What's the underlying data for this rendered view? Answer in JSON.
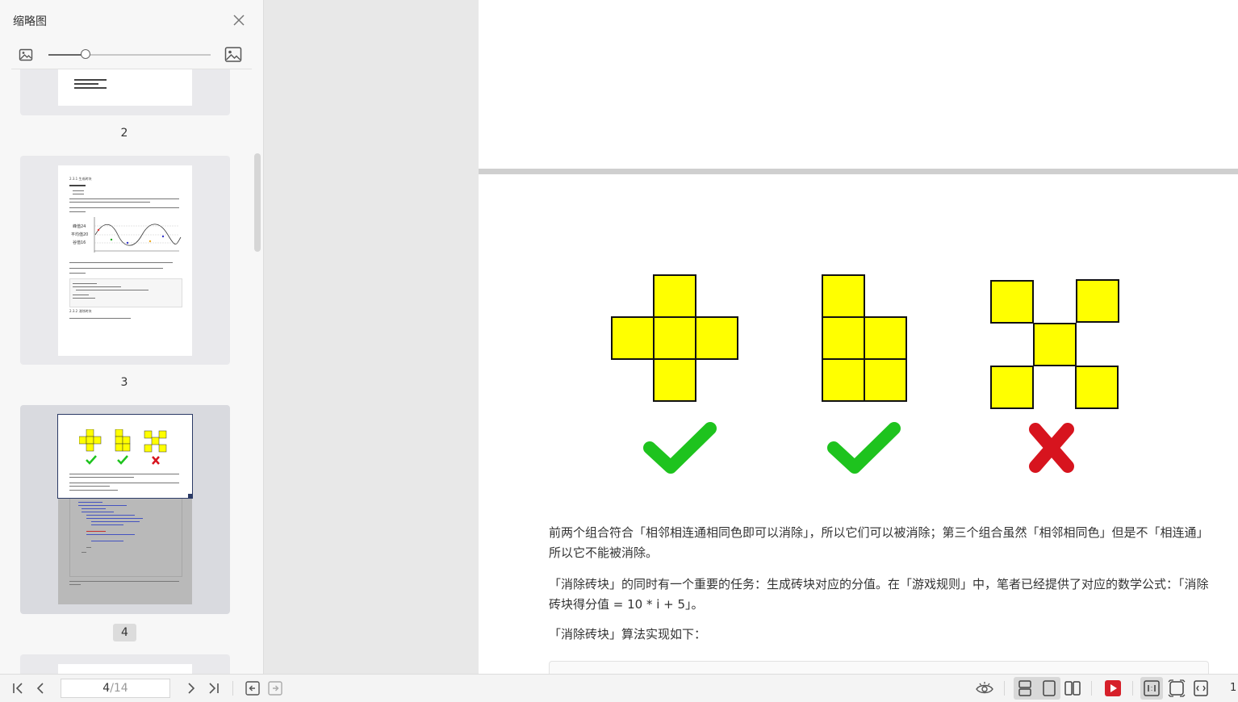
{
  "sidebar": {
    "title": "缩略图",
    "thumbnails": [
      {
        "label": "2"
      },
      {
        "label": "3",
        "mini": {
          "section_a": "2.3.1 生成砖块",
          "section_b": "2.3.2 消除砖块",
          "axis_max": "峰值24",
          "axis_mid": "平均值20",
          "axis_min": "谷值16"
        }
      },
      {
        "label": "4"
      }
    ]
  },
  "document": {
    "figure": {
      "groups": [
        "plus",
        "l-shape",
        "x-shape"
      ],
      "marks": [
        "check",
        "check",
        "cross"
      ],
      "tile_color": "#ffff00",
      "check_color": "#1ec31e",
      "cross_color": "#d7141e"
    },
    "paragraphs": [
      "前两个组合符合「相邻相连通相同色即可以消除」，所以它们可以被消除；第三个组合虽然「相邻相同色」但是不「相连通」所以它不能被消除。",
      "「消除砖块」的同时有一个重要的任务：生成砖块对应的分值。在「游戏规则」中，笔者已经提供了对应的数学公式：「消除砖块得分值 = 10 * i + 5」。",
      "「消除砖块」算法实现如下："
    ]
  },
  "toolbar": {
    "page_current": "4",
    "page_total": "/14",
    "zoom_text": "1"
  }
}
